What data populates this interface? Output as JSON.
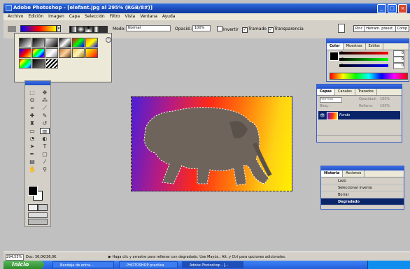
{
  "titlebar": {
    "title": "Adobe Photoshop - [elefant.jpg al 295% (RGB/8#)]"
  },
  "menu": [
    "Archivo",
    "Edición",
    "Imagen",
    "Capa",
    "Selección",
    "Filtro",
    "Vista",
    "Ventana",
    "Ayuda"
  ],
  "options": {
    "modo_label": "Modo:",
    "modo_value": "Normal",
    "opacidad_label": "Opacid.:",
    "opacidad_value": "100%",
    "invertir": "Invertir",
    "tramado": "Tramado",
    "transparencia": "Transparencia",
    "tab_pinceles": "Pinc",
    "tab_herram": "Herram. preest.",
    "tab_comp": "Comp"
  },
  "color_panel": {
    "tabs": [
      "Color",
      "Muestras",
      "Estilos"
    ],
    "labels": [
      "R",
      "G",
      "B"
    ],
    "values": [
      "0",
      "0",
      "0"
    ]
  },
  "layers_panel": {
    "tabs": [
      "Capas",
      "Canales",
      "Trazados"
    ],
    "mode": "Normal",
    "opacity_label": "Opacidad:",
    "opacity": "100%",
    "lock_label": "Bloq.:",
    "fill_label": "Relleno:",
    "fill": "100%",
    "layer_name": "Fondo"
  },
  "history_panel": {
    "tabs": [
      "Historia",
      "Acciones"
    ],
    "items": [
      "Lazo",
      "Seleccionar inverso",
      "Borrar",
      "Degradado"
    ],
    "selected": "Degradado"
  },
  "status": {
    "zoom": "294,55%",
    "doc": "Doc: 36,0K/36,0K",
    "hint": "Haga clic y arrastre para rellenar con degradado. Use Mayús., Alt, y Ctrl para opciones adicionales."
  },
  "taskbar": {
    "start": "Inicio",
    "items": [
      "Bandeja de entra...",
      "PHOTOSHOP practica",
      "Adobe Photoshop - [..."
    ]
  },
  "colors": {
    "titlebar": "#1a48b8",
    "gradient_start": "#4a1fd8",
    "gradient_mid": "#ff2a16",
    "gradient_end": "#fff000"
  }
}
